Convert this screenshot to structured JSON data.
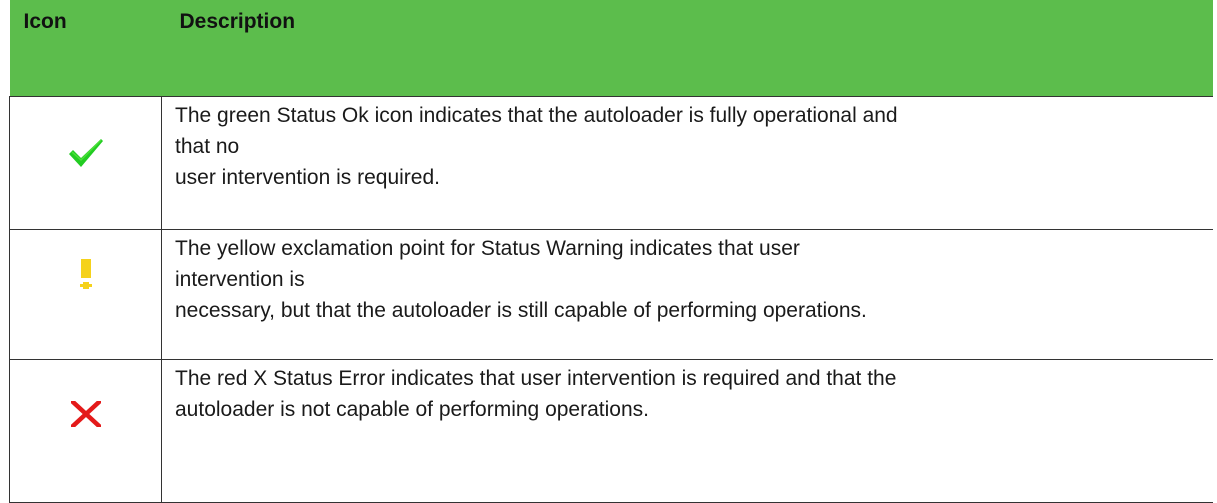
{
  "table": {
    "headers": {
      "icon": "Icon",
      "description": "Description"
    },
    "rows": [
      {
        "status": "ok",
        "icon": "checkmark-icon",
        "icon_color": "#22cc22",
        "lines": [
          "The green Status Ok icon indicates that the autoloader is fully operational and",
          "that no",
          "user intervention is required."
        ]
      },
      {
        "status": "warning",
        "icon": "exclamation-icon",
        "icon_color": "#f5d21b",
        "lines": [
          "The yellow exclamation point for Status Warning indicates that user",
          "intervention is",
          "necessary, but that the autoloader is still capable of performing operations."
        ]
      },
      {
        "status": "error",
        "icon": "x-icon",
        "icon_color": "#e41a1a",
        "lines": [
          "The red X Status Error indicates that user intervention is required and that the",
          "autoloader is not capable of performing operations."
        ]
      }
    ],
    "header_color": "#5cbd4c"
  }
}
